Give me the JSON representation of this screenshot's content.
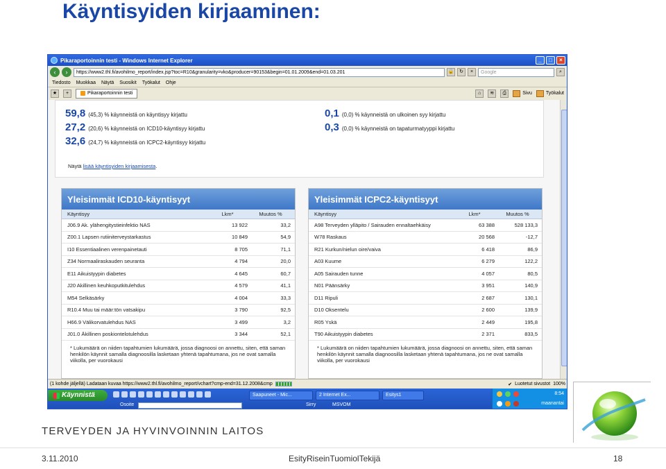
{
  "slide": {
    "title": "Käyntisyiden kirjaaminen:",
    "org": "TERVEYDEN JA HYVINVOINNIN LAITOS",
    "footer": {
      "date": "3.11.2010",
      "author": "EsityRiseinTuomiolTekijä",
      "page": "18"
    }
  },
  "window": {
    "title": "Pikaraportoinnin testi - Windows Internet Explorer",
    "url": "https://www2.thl.fi/avohilmo_report/index.jsp?toc=R10&granularity=vko&producer=90153&begin=01.01.2009&end=01.03.201",
    "search_placeholder": "Google",
    "menu": [
      "Tiedosto",
      "Muokkaa",
      "Näytä",
      "Suosikit",
      "Työkalut",
      "Ohje"
    ],
    "tab_label": "Pikaraportoinnin testi",
    "cmd_page": "Sivu",
    "cmd_tools": "Työkalut",
    "status_text": "(1 kohde jäljellä) Ladataan kuvaa https://www2.thl.fi/avohilmo_report/vchart?cmp-end=31.12.2008&cmp",
    "status_zone": "Luotetut sivustot",
    "status_zoom": "100%"
  },
  "stats": {
    "left": [
      {
        "value": "59,8",
        "text": "(45,3) % käynneistä on käyntisyy kirjattu"
      },
      {
        "value": "27,2",
        "text": "(20,6) % käynneistä on ICD10-käyntisyy kirjattu"
      },
      {
        "value": "32,6",
        "text": "(24,7) % käynneistä on ICPC2-käyntisyy kirjattu"
      }
    ],
    "right": [
      {
        "value": "0,1",
        "text": "(0,0) % käynneistä on ulkoinen syy kirjattu"
      },
      {
        "value": "0,3",
        "text": "(0,0) % käynneistä on tapaturmatyyppi kirjattu"
      }
    ],
    "show_prefix": "Näytä",
    "show_link": "lisää käyntisyiden kirjaamisesta",
    "show_suffix": "."
  },
  "icd10": {
    "title": "Yleisimmät ICD10-käyntisyyt",
    "columns": [
      "Käyntisyy",
      "Lkm*",
      "Muutos %"
    ],
    "rows": [
      [
        "J06.9 Ak. ylähengitystieinfektio NAS",
        "13 922",
        "33,2"
      ],
      [
        "Z00.1 Lapsen rutiiniterveystarkastus",
        "10 849",
        "54,9"
      ],
      [
        "I10 Essentiaalinen verenpainetauti",
        "8 705",
        "71,1"
      ],
      [
        "Z34 Normaaliraskauden seuranta",
        "4 794",
        "20,0"
      ],
      [
        "E11 Aikuistyypin diabetes",
        "4 645",
        "60,7"
      ],
      [
        "J20 Akillinen keuhkoputkitulehdus",
        "4 579",
        "41,1"
      ],
      [
        "M54 Selkäsärky",
        "4 004",
        "33,3"
      ],
      [
        "R10.4 Muu tai määr:tön vatsakipu",
        "3 790",
        "92,5"
      ],
      [
        "H66.9 Välikorvatulehdus NAS",
        "3 499",
        "3,2"
      ],
      [
        "J01.0 Äkillinen poskiontelotulehdus",
        "3 344",
        "52,1"
      ]
    ],
    "note": "* Lukumäärä on niiden tapahtumien lukumäärä, jossa diagnoosi on annettu, siten, että saman henkilön käynnit samalla diagnoosilla lasketaan yhtenä tapahtumana, jos ne ovat samalla viikolla, per vuorokausi"
  },
  "icpc2": {
    "title": "Yleisimmät ICPC2-käyntisyyt",
    "columns": [
      "Käyntisyy",
      "Lkm*",
      "Muutos %"
    ],
    "rows": [
      [
        "A98 Terveyden ylläpito / Sairauden ennaltaehkäisy",
        "63 388",
        "528 133,3"
      ],
      [
        "W78 Raskaus",
        "20 568",
        "-12,7"
      ],
      [
        "R21 Kurkun/nielun oire/vaiva",
        "6 418",
        "86,9"
      ],
      [
        "A03 Kuume",
        "6 279",
        "122,2"
      ],
      [
        "A05 Sairauden tunne",
        "4 057",
        "80,5"
      ],
      [
        "N01 Päänsärky",
        "3 951",
        "140,9"
      ],
      [
        "D11 Ripuli",
        "2 687",
        "130,1"
      ],
      [
        "D10 Oksentelu",
        "2 600",
        "139,9"
      ],
      [
        "R05 Yskä",
        "2 449",
        "195,8"
      ],
      [
        "T90 Aikuistyypin diabetes",
        "2 371",
        "833,5"
      ]
    ],
    "note": "* Lukumäärä on niiden tapahtumien lukumäärä, jossa diagnoosi on annettu, siten, että saman henkilön käynnit samalla diagnoosilla lasketaan yhtenä tapahtumana, jos ne ovat samalla viikolla, per vuorokausi"
  },
  "taskbar": {
    "start": "Käynnistä",
    "tasks": [
      "Saapuneet - Mic...",
      "2 Internet Ex...",
      "Esitys1"
    ],
    "row2": [
      "Osoite",
      "Sirry",
      "MSVOM"
    ],
    "time": "8:54",
    "day": "maanantai"
  },
  "colors": {
    "accent": "#1a47a6",
    "panel_head": "#4f86cf",
    "taskbar": "#245edb",
    "start": "#3aa63a"
  }
}
